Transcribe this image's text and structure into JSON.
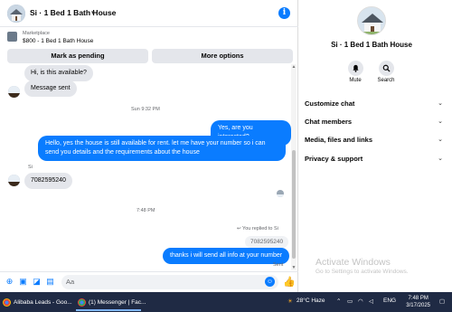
{
  "chat": {
    "title": "Si · 1 Bed 1 Bath House",
    "marketplace": {
      "label": "Marketplace",
      "item": "$800 - 1 Bed 1 Bath House",
      "mark_pending": "Mark as pending",
      "more_options": "More options"
    },
    "messages": {
      "in1": "Hi, is this available?",
      "in2": "Message sent",
      "ts1": "Sun 9:32 PM",
      "out1": "Yes, are you interested?",
      "out2": "Hello, yes the house is still available for rent. let me have your number so i can send you details and the requirements about the house",
      "sender": "Si",
      "in3": "7082595240",
      "ts2": "7:48 PM",
      "reply_label": "You replied to Si",
      "reply_quote": "7082595240",
      "out3": "thanks i will send all info at your number",
      "status": "Sent"
    },
    "composer": {
      "placeholder": "Aa"
    }
  },
  "side": {
    "name": "Si · 1 Bed 1 Bath House",
    "mute": "Mute",
    "search": "Search",
    "items": [
      "Customize chat",
      "Chat members",
      "Media, files and links",
      "Privacy & support"
    ],
    "activate_title": "Activate Windows",
    "activate_sub": "Go to Settings to activate Windows."
  },
  "taskbar": {
    "task1": "Alibaba Leads - Goo...",
    "task2": "(1) Messenger | Fac...",
    "weather": "28°C  Haze",
    "lang": "ENG",
    "time": "7:48 PM",
    "date": "3/17/2025"
  }
}
